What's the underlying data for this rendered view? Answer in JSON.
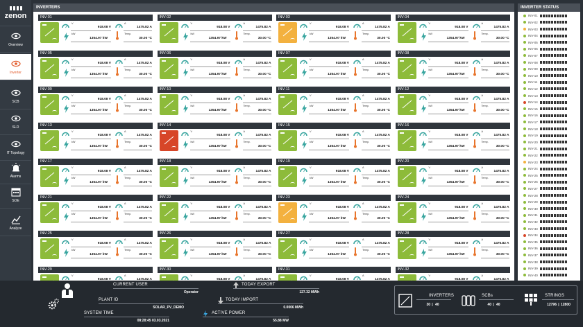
{
  "app": {
    "logo_text": "zenon"
  },
  "nav": [
    {
      "label": "Overview",
      "icon": "eye-icon"
    },
    {
      "label": "Inverter",
      "icon": "eye-icon",
      "active": true
    },
    {
      "label": "SCB",
      "icon": "eye-icon"
    },
    {
      "label": "SLD",
      "icon": "eye-icon"
    },
    {
      "label": "IT Topology",
      "icon": "eye-icon"
    },
    {
      "label": "Alarms",
      "icon": "alarm-icon"
    },
    {
      "label": "SOE",
      "icon": "calendar-icon"
    },
    {
      "label": "Analyze",
      "icon": "chart-icon"
    }
  ],
  "inverters_panel": {
    "title": "INVERTERS"
  },
  "card_labels": {
    "v": "V",
    "a": "A",
    "kw": "kW",
    "temp": "Temp."
  },
  "card_values": {
    "voltage": "918.08 V",
    "current": "1475.82 A",
    "power": "1354.97 kW",
    "temperature": "30.00 °C"
  },
  "inverters": [
    {
      "name": "INV-01",
      "state": "ok"
    },
    {
      "name": "INV-02",
      "state": "ok"
    },
    {
      "name": "INV-03",
      "state": "warn"
    },
    {
      "name": "INV-04",
      "state": "ok"
    },
    {
      "name": "INV-05",
      "state": "ok"
    },
    {
      "name": "INV-06",
      "state": "ok"
    },
    {
      "name": "INV-07",
      "state": "ok"
    },
    {
      "name": "INV-08",
      "state": "ok"
    },
    {
      "name": "INV-09",
      "state": "ok"
    },
    {
      "name": "INV-10",
      "state": "ok"
    },
    {
      "name": "INV-11",
      "state": "ok"
    },
    {
      "name": "INV-12",
      "state": "ok"
    },
    {
      "name": "INV-13",
      "state": "ok"
    },
    {
      "name": "INV-14",
      "state": "err"
    },
    {
      "name": "INV-15",
      "state": "ok"
    },
    {
      "name": "INV-16",
      "state": "ok"
    },
    {
      "name": "INV-17",
      "state": "ok"
    },
    {
      "name": "INV-18",
      "state": "ok"
    },
    {
      "name": "INV-19",
      "state": "ok"
    },
    {
      "name": "INV-20",
      "state": "ok"
    },
    {
      "name": "INV-21",
      "state": "ok"
    },
    {
      "name": "INV-22",
      "state": "ok"
    },
    {
      "name": "INV-23",
      "state": "warn"
    },
    {
      "name": "INV-24",
      "state": "ok"
    },
    {
      "name": "INV-25",
      "state": "ok"
    },
    {
      "name": "INV-26",
      "state": "ok"
    },
    {
      "name": "INV-27",
      "state": "ok"
    },
    {
      "name": "INV-28",
      "state": "ok"
    },
    {
      "name": "INV-29",
      "state": "ok"
    },
    {
      "name": "INV-30",
      "state": "ok"
    },
    {
      "name": "INV-31",
      "state": "ok"
    },
    {
      "name": "INV-32",
      "state": "ok"
    }
  ],
  "status_panel": {
    "title": "INVERTER STATUS",
    "rows": [
      {
        "name": "INV-01",
        "state": "ok"
      },
      {
        "name": "INV-02",
        "state": "ok"
      },
      {
        "name": "INV-03",
        "state": "warn"
      },
      {
        "name": "INV-04",
        "state": "ok"
      },
      {
        "name": "INV-05",
        "state": "ok"
      },
      {
        "name": "INV-06",
        "state": "ok"
      },
      {
        "name": "INV-07",
        "state": "ok"
      },
      {
        "name": "INV-08",
        "state": "ok"
      },
      {
        "name": "INV-09",
        "state": "ok"
      },
      {
        "name": "INV-10",
        "state": "ok"
      },
      {
        "name": "INV-11",
        "state": "ok"
      },
      {
        "name": "INV-12",
        "state": "ok"
      },
      {
        "name": "INV-13",
        "state": "ok"
      },
      {
        "name": "INV-14",
        "state": "err"
      },
      {
        "name": "INV-15",
        "state": "ok"
      },
      {
        "name": "INV-16",
        "state": "ok"
      },
      {
        "name": "INV-17",
        "state": "ok"
      },
      {
        "name": "INV-18",
        "state": "ok"
      },
      {
        "name": "INV-19",
        "state": "ok"
      },
      {
        "name": "INV-20",
        "state": "ok"
      },
      {
        "name": "INV-21",
        "state": "ok"
      },
      {
        "name": "INV-22",
        "state": "ok"
      },
      {
        "name": "INV-23",
        "state": "warn"
      },
      {
        "name": "INV-24",
        "state": "ok"
      },
      {
        "name": "INV-25",
        "state": "ok"
      },
      {
        "name": "INV-26",
        "state": "ok"
      },
      {
        "name": "INV-27",
        "state": "ok"
      },
      {
        "name": "INV-28",
        "state": "ok"
      },
      {
        "name": "INV-29",
        "state": "ok"
      },
      {
        "name": "INV-30",
        "state": "ok"
      },
      {
        "name": "INV-31",
        "state": "ok"
      },
      {
        "name": "INV-32",
        "state": "ok"
      },
      {
        "name": "INV-33",
        "state": "ok"
      },
      {
        "name": "INV-34",
        "state": "err"
      },
      {
        "name": "INV-35",
        "state": "ok"
      },
      {
        "name": "INV-36",
        "state": "ok"
      },
      {
        "name": "INV-37",
        "state": "ok"
      },
      {
        "name": "INV-38",
        "state": "ok"
      },
      {
        "name": "INV-39",
        "state": "ok"
      },
      {
        "name": "INV-40",
        "state": "ok"
      }
    ]
  },
  "footer": {
    "current_user_label": "CURRENT USER",
    "current_user_value": "Operator",
    "plant_id_label": "PLANT ID",
    "plant_id_value": "SOLAR_PV_DEMO",
    "system_time_label": "SYSTEM TIME",
    "system_time_value": "08:28:45 03.03.2021",
    "today_export_label": "TODAY EXPORT",
    "today_export_value": "127.32 MWh",
    "today_import_label": "TODAY IMPORT",
    "today_import_value": "0.0006 MWh",
    "active_power_label": "ACTIVE POWER",
    "active_power_value": "55.88 MW",
    "inverters_label": "INVERTERS",
    "inverters_a": "30",
    "inverters_b": "40",
    "scbs_label": "SCBs",
    "scbs_a": "40",
    "scbs_b": "40",
    "strings_label": "STRINGS",
    "strings_a": "12796",
    "strings_b": "12800"
  },
  "colors": {
    "ok": "#8dbb3a",
    "warn": "#f3b13f",
    "err": "#d74628",
    "accent": "#e25b2b",
    "gauge": "#3aa6a0"
  }
}
